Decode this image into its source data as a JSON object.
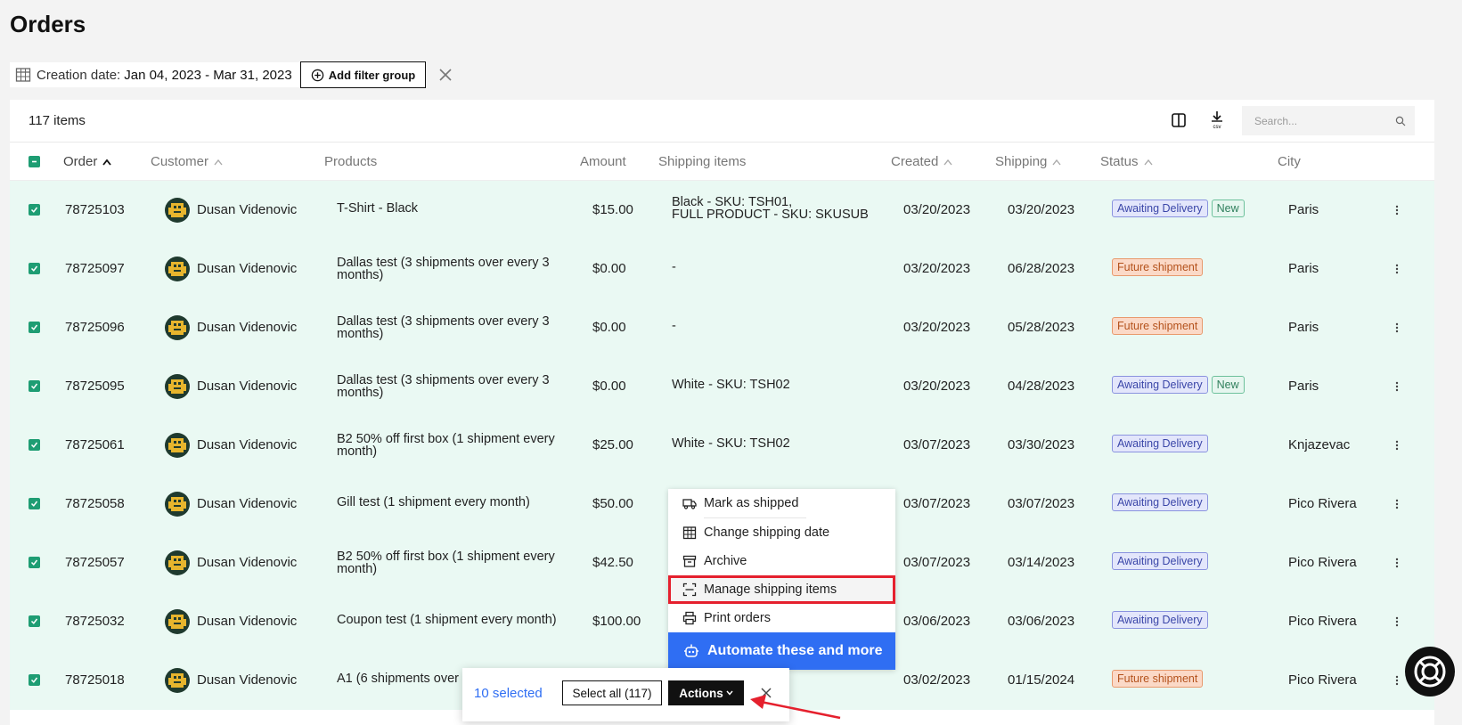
{
  "page": {
    "title": "Orders"
  },
  "filters": {
    "date_label": "Creation date:",
    "date_range": "Jan 04, 2023 - Mar 31, 2023",
    "add_filter_label": "Add filter group"
  },
  "table": {
    "items_count": "117 items",
    "search_placeholder": "Search...",
    "csv_label": "csv",
    "columns": {
      "order": "Order",
      "customer": "Customer",
      "products": "Products",
      "amount": "Amount",
      "shipping_items": "Shipping items",
      "created": "Created",
      "shipping": "Shipping",
      "status": "Status",
      "city": "City"
    },
    "rows": [
      {
        "order": "78725103",
        "customer": "Dusan Videnovic",
        "products": "T-Shirt - Black",
        "amount": "$15.00",
        "shipping_items": "Black - SKU: TSH01,\nFULL PRODUCT - SKU: SKUSUB",
        "created": "03/20/2023",
        "shipping": "03/20/2023",
        "status": "Awaiting Delivery",
        "badge2": "New",
        "city": "Paris"
      },
      {
        "order": "78725097",
        "customer": "Dusan Videnovic",
        "products": "Dallas test (3 shipments over every 3 months)",
        "amount": "$0.00",
        "shipping_items": "-",
        "created": "03/20/2023",
        "shipping": "06/28/2023",
        "status": "Future shipment",
        "badge2": "",
        "city": "Paris"
      },
      {
        "order": "78725096",
        "customer": "Dusan Videnovic",
        "products": "Dallas test (3 shipments over every 3 months)",
        "amount": "$0.00",
        "shipping_items": "-",
        "created": "03/20/2023",
        "shipping": "05/28/2023",
        "status": "Future shipment",
        "badge2": "",
        "city": "Paris"
      },
      {
        "order": "78725095",
        "customer": "Dusan Videnovic",
        "products": "Dallas test (3 shipments over every 3 months)",
        "amount": "$0.00",
        "shipping_items": "White - SKU: TSH02",
        "created": "03/20/2023",
        "shipping": "04/28/2023",
        "status": "Awaiting Delivery",
        "badge2": "New",
        "city": "Paris"
      },
      {
        "order": "78725061",
        "customer": "Dusan Videnovic",
        "products": "B2 50% off first box (1 shipment every month)",
        "amount": "$25.00",
        "shipping_items": "White - SKU: TSH02",
        "created": "03/07/2023",
        "shipping": "03/30/2023",
        "status": "Awaiting Delivery",
        "badge2": "",
        "city": "Knjazevac"
      },
      {
        "order": "78725058",
        "customer": "Dusan Videnovic",
        "products": "Gill test (1 shipment every month)",
        "amount": "$50.00",
        "shipping_items": "",
        "created": "03/07/2023",
        "shipping": "03/07/2023",
        "status": "Awaiting Delivery",
        "badge2": "",
        "city": "Pico Rivera"
      },
      {
        "order": "78725057",
        "customer": "Dusan Videnovic",
        "products": "B2 50% off first box (1 shipment every month)",
        "amount": "$42.50",
        "shipping_items": "",
        "created": "03/07/2023",
        "shipping": "03/14/2023",
        "status": "Awaiting Delivery",
        "badge2": "",
        "city": "Pico Rivera"
      },
      {
        "order": "78725032",
        "customer": "Dusan Videnovic",
        "products": "Coupon test (1 shipment every month)",
        "amount": "$100.00",
        "shipping_items": "",
        "created": "03/06/2023",
        "shipping": "03/06/2023",
        "status": "Awaiting Delivery",
        "badge2": "",
        "city": "Pico Rivera"
      },
      {
        "order": "78725018",
        "customer": "Dusan Videnovic",
        "products": "A1 (6 shipments over",
        "amount": "",
        "shipping_items": "",
        "created": "03/02/2023",
        "shipping": "01/15/2024",
        "status": "Future shipment",
        "badge2": "",
        "city": "Pico Rivera"
      }
    ]
  },
  "actions_menu": {
    "items": [
      {
        "label": "Mark as shipped",
        "icon": "truck-icon"
      },
      {
        "label": "Change shipping date",
        "icon": "calendar-icon"
      },
      {
        "label": "Archive",
        "icon": "archive-icon"
      },
      {
        "label": "Manage shipping items",
        "icon": "scan-icon"
      },
      {
        "label": "Print orders",
        "icon": "printer-icon"
      }
    ],
    "automate_label": "Automate these and more"
  },
  "bulk_bar": {
    "selected": "10 selected",
    "select_all": "Select all (117)",
    "actions": "Actions"
  },
  "colors": {
    "accent": "#2f6ef3",
    "row_selected": "#eaf9f3",
    "checkbox": "#1e9d73",
    "highlight": "#e5202d"
  }
}
